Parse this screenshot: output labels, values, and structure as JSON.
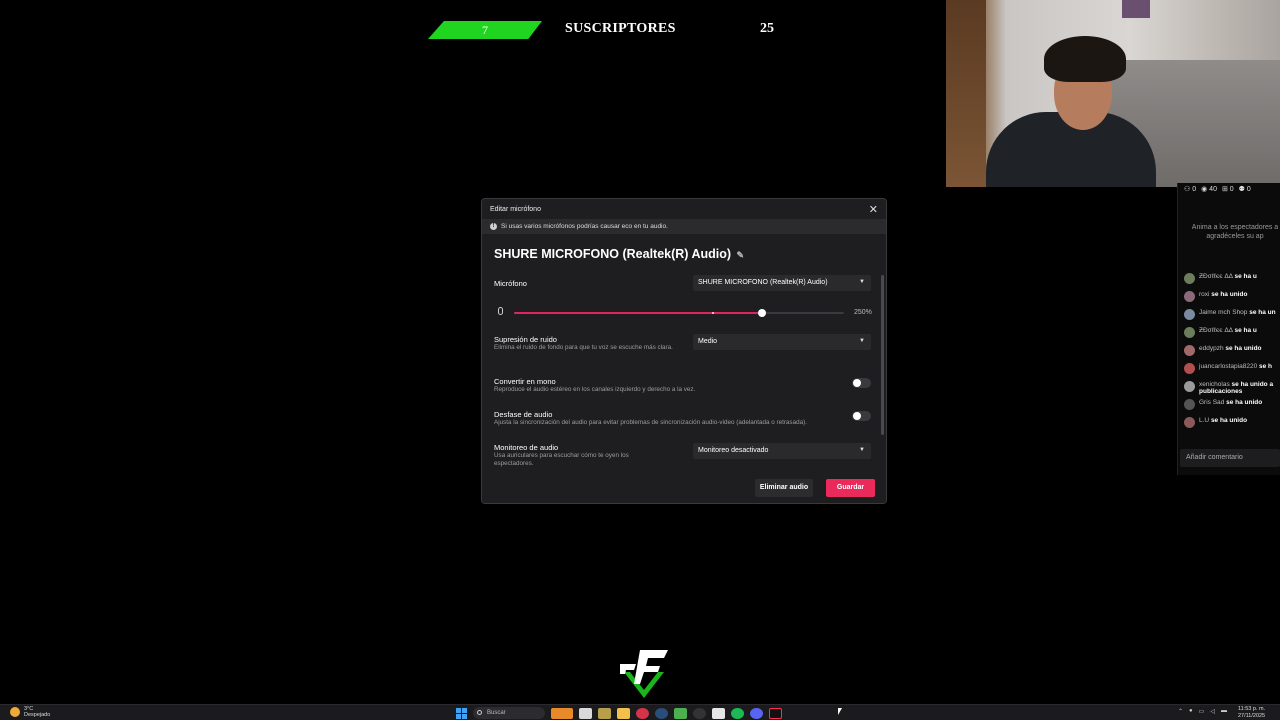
{
  "subscriber_bar": {
    "count": "7",
    "label": "SUSCRIPTORES",
    "goal": "25",
    "accent": "#1fd51f"
  },
  "dialog": {
    "title": "Editar micrófono",
    "warning": "Si usas varios micrófonos podrías causar eco en tu audio.",
    "device_name": "SHURE MICROFONO (Realtek(R) Audio)",
    "microphone": {
      "label": "Micrófono",
      "value": "SHURE MICROFONO (Realtek(R) Audio)"
    },
    "volume": {
      "value_text": "250%",
      "fraction": 0.75,
      "accent": "#e0245e"
    },
    "noise": {
      "label": "Supresión de ruido",
      "desc": "Elimina el ruido de fondo para que tu voz se escuche más clara.",
      "value": "Medio"
    },
    "mono": {
      "label": "Convertir en mono",
      "desc": "Reproduce el audio estéreo en los canales izquierdo y derecho a la vez.",
      "enabled": false
    },
    "offset": {
      "label": "Desfase de audio",
      "desc": "Ajusta la sincronización del audio para evitar problemas de sincronización audio-video (adelantada o retrasada).",
      "enabled": false
    },
    "monitor": {
      "label": "Monitoreo de audio",
      "desc": "Usa auriculares para escuchar cómo te oyen los espectadores.",
      "value": "Monitoreo desactivado"
    },
    "delete_label": "Eliminar audio",
    "save_label": "Guardar",
    "save_color": "#ea2a5b"
  },
  "chat": {
    "stats": [
      "⚇ 0",
      "◉ 40",
      "⊞ 0",
      "⚉ 0"
    ],
    "notice_line1": "Anima a los espectadores a",
    "notice_line2": "agradéceles su ap",
    "messages": [
      {
        "user": "ƵĐσℓℓєє ΔΔ",
        "text": "se ha u",
        "color": "#6b7d5a"
      },
      {
        "user": "roxi",
        "text": "se ha unido",
        "color": "#8a6a7a"
      },
      {
        "user": "Jaime mch Shop",
        "text": "se ha un",
        "color": "#7a8aa0"
      },
      {
        "user": "ƵĐσℓℓєє ΔΔ",
        "text": "se ha u",
        "color": "#6b7d5a"
      },
      {
        "user": "eddypzh",
        "text": "se ha unido",
        "color": "#a06a6a"
      },
      {
        "user": "juancarlostapia8220",
        "text": "se h",
        "color": "#b05050"
      },
      {
        "user": "xenicholas",
        "text": "se ha unido a",
        "text2": "publicaciones",
        "color": "#9a9a9a"
      },
      {
        "user": "Gris Sad",
        "text": "se ha unido",
        "color": "#555"
      },
      {
        "user": "L.U",
        "text": "se ha unido",
        "color": "#8a5a5a"
      }
    ],
    "input_placeholder": "Añadir comentario"
  },
  "taskbar": {
    "weather_temp": "3°C",
    "weather_text": "Despejado",
    "search_placeholder": "Buscar",
    "time": "11:53 p. m.",
    "date": "27/11/2025"
  }
}
